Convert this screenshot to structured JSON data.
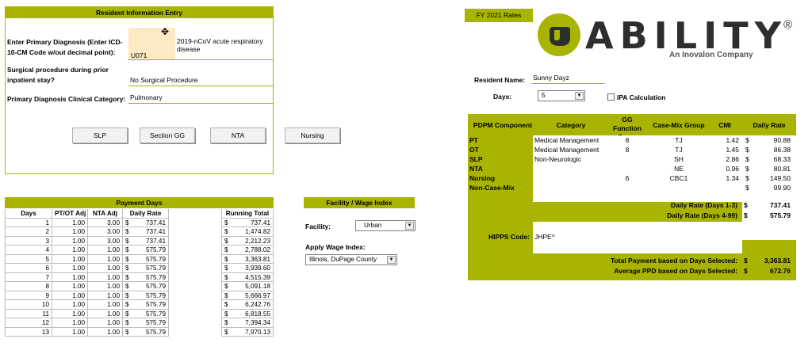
{
  "entry": {
    "title": "Resident Information Entry",
    "diagnosis_label": "Enter Primary Diagnosis (Enter ICD-10-CM Code w/out decimal point):",
    "diagnosis_code": "U071",
    "diagnosis_desc": "2019-nCoV acute respiratory disease",
    "surgical_label": "Surgical procedure during prior inpatient stay?",
    "surgical_value": "No Surgical Procedure",
    "category_label": "Primary Diagnosis Clinical Category:",
    "category_value": "Pulmonary",
    "buttons": [
      "SLP",
      "Section GG",
      "NTA",
      "Nursing"
    ]
  },
  "payment": {
    "title": "Payment Days",
    "headers": [
      "Days",
      "PT/OT Adj",
      "NTA Adj",
      "Daily Rate",
      "Running Total"
    ],
    "rows": [
      [
        "1",
        "1.00",
        "3.00",
        "737.41",
        "737.41"
      ],
      [
        "2",
        "1.00",
        "3.00",
        "737.41",
        "1,474.82"
      ],
      [
        "3",
        "1.00",
        "3.00",
        "737.41",
        "2,212.23"
      ],
      [
        "4",
        "1.00",
        "1.00",
        "575.79",
        "2,788.02"
      ],
      [
        "5",
        "1.00",
        "1.00",
        "575.79",
        "3,363.81"
      ],
      [
        "6",
        "1.00",
        "1.00",
        "575.79",
        "3,939.60"
      ],
      [
        "7",
        "1.00",
        "1.00",
        "575.79",
        "4,515.39"
      ],
      [
        "8",
        "1.00",
        "1.00",
        "575.79",
        "5,091.18"
      ],
      [
        "9",
        "1.00",
        "1.00",
        "575.79",
        "5,666.97"
      ],
      [
        "10",
        "1.00",
        "1.00",
        "575.79",
        "6,242.76"
      ],
      [
        "11",
        "1.00",
        "1.00",
        "575.79",
        "6,818.55"
      ],
      [
        "12",
        "1.00",
        "1.00",
        "575.79",
        "7,394.34"
      ],
      [
        "13",
        "1.00",
        "1.00",
        "575.79",
        "7,970.13"
      ]
    ]
  },
  "facility": {
    "title": "Facility / Wage Index",
    "facility_label": "Facility:",
    "facility_value": "Urban",
    "wage_label": "Apply Wage Index:",
    "wage_value": "Illinois, DuPage County"
  },
  "rates": {
    "fy_tab": "FY 2021 Rates",
    "logo_text": "ABILITY",
    "logo_mark": "®",
    "logo_sub": "An Inovalon Company",
    "resident_label": "Resident Name:",
    "resident_value": "Sunny Dayz",
    "days_label": "Days:",
    "days_value": "5",
    "ipa_label": "IPA Calculation",
    "headers": [
      "PDPM Component",
      "Category",
      "GG Function Score",
      "Case-Mix Group",
      "CMI",
      "Daily Rate"
    ],
    "components": [
      {
        "name": "PT",
        "category": "Medical Management",
        "gg": "8",
        "group": "TJ",
        "cmi": "1.42",
        "rate": "90.88"
      },
      {
        "name": "OT",
        "category": "Medical Management",
        "gg": "8",
        "group": "TJ",
        "cmi": "1.45",
        "rate": "86.38"
      },
      {
        "name": "SLP",
        "category": "Non-Neurologic",
        "gg": "",
        "group": "SH",
        "cmi": "2.86",
        "rate": "68.33"
      },
      {
        "name": "NTA",
        "category": "",
        "gg": "",
        "group": "NE",
        "cmi": "0.96",
        "rate": "80.81"
      },
      {
        "name": "Nursing",
        "category": "",
        "gg": "6",
        "group": "CBC1",
        "cmi": "1.34",
        "rate": "149.50"
      },
      {
        "name": "Non-Case-Mix",
        "category": "",
        "gg": "",
        "group": "",
        "cmi": "",
        "rate": "99.90"
      }
    ],
    "daily_1_3_label": "Daily Rate (Days 1-3)",
    "daily_1_3_value": "737.41",
    "daily_4_99_label": "Daily Rate (Days 4-99)",
    "daily_4_99_value": "575.79",
    "hipps_label": "HIPPS Code:",
    "hipps_value": "JHPE^",
    "total_label": "Total Payment based on Days Selected:",
    "total_value": "3,363.81",
    "avg_label": "Average PPD based on Days Selected:",
    "avg_value": "672.76",
    "currency": "$"
  },
  "colors": {
    "accent": "#a8b400",
    "input_fill": "#fde9c4",
    "brand_dark": "#2c2f2c"
  }
}
